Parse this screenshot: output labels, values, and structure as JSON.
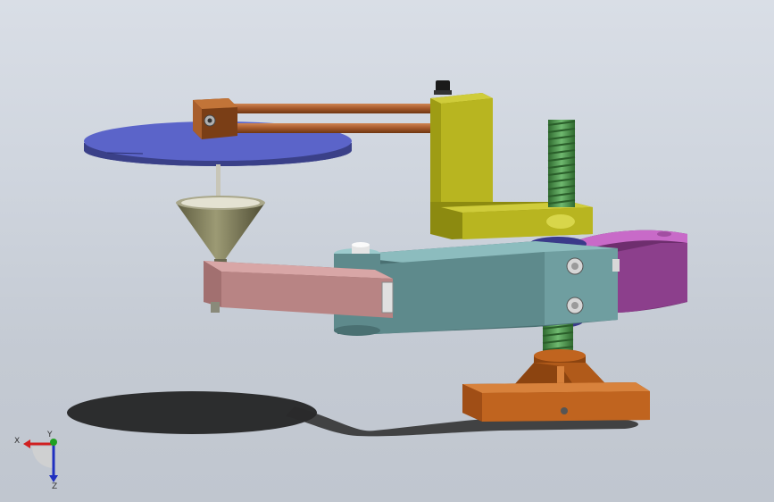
{
  "viewport": {
    "background_top": "#d9dee6",
    "background_bottom": "#c0c6cf"
  },
  "triad": {
    "x_label": "X",
    "y_label": "Y",
    "z_label": "Z",
    "x_color": "#d02020",
    "y_color": "#20a020",
    "z_color": "#2030c0"
  },
  "model": {
    "parts": [
      {
        "name": "platter",
        "color": "#5b64c9"
      },
      {
        "name": "guide-rods",
        "color": "#b8683a"
      },
      {
        "name": "rod-clamp-block",
        "color": "#a85e2c"
      },
      {
        "name": "l-bracket",
        "color": "#b8b520"
      },
      {
        "name": "compression-spring",
        "color": "#4f9a4f"
      },
      {
        "name": "funnel-cone",
        "color": "#7a7758"
      },
      {
        "name": "link-arm",
        "color": "#b88484"
      },
      {
        "name": "main-arm",
        "color": "#5e8a8c"
      },
      {
        "name": "cam-plate",
        "color": "#8c3f8c"
      },
      {
        "name": "base-plate",
        "color": "#c0641f"
      }
    ]
  }
}
